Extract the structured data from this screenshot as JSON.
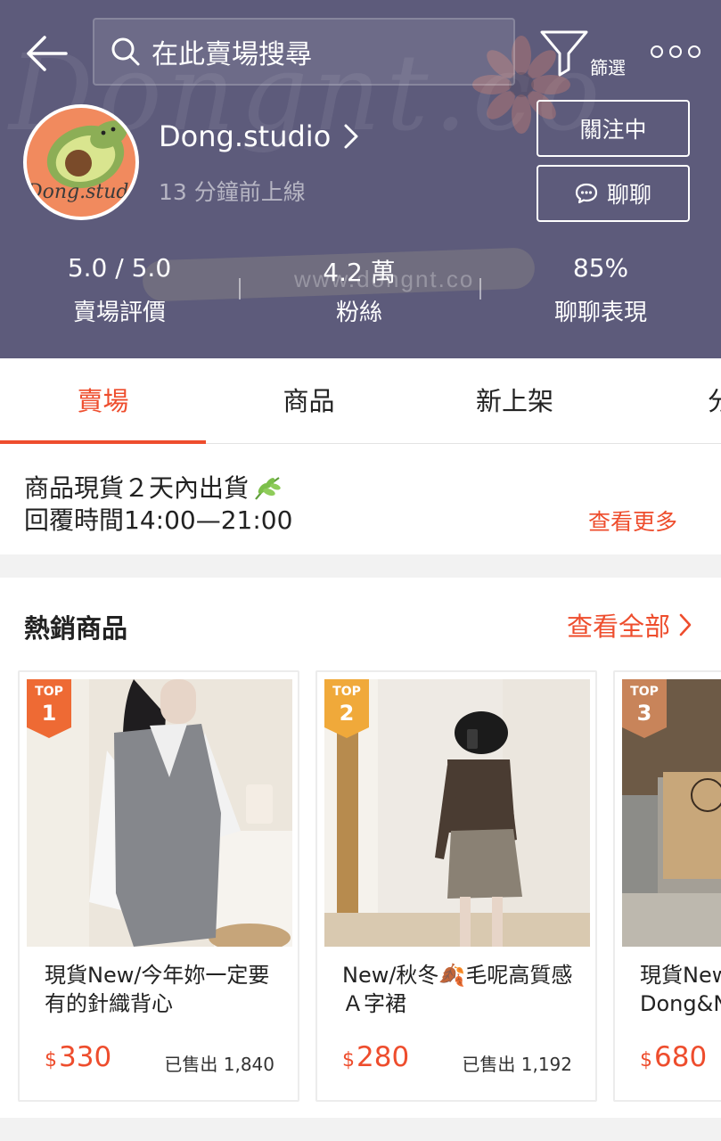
{
  "header": {
    "search_placeholder": "在此賣場搜尋",
    "filter_label": "篩選",
    "watermark_text": "Dongnt.co",
    "watermark_url": "www.dongnt.co"
  },
  "shop": {
    "avatar_text": "Dong.studio",
    "name": "Dong.studio",
    "last_online": "13 分鐘前上線",
    "follow_label": "關注中",
    "chat_label": "聊聊"
  },
  "stats": [
    {
      "value": "5.0 / 5.0",
      "label": "賣場評價"
    },
    {
      "value": "4.2 萬",
      "label": "粉絲"
    },
    {
      "value": "85%",
      "label": "聊聊表現"
    }
  ],
  "tabs": [
    {
      "label": "賣場",
      "active": true
    },
    {
      "label": "商品",
      "active": false
    },
    {
      "label": "新上架",
      "active": false
    },
    {
      "label": "分",
      "active": false
    }
  ],
  "notice": {
    "line1": "商品現貨２天內出貨",
    "line2": "回覆時間14:00—21:00",
    "see_more": "查看更多"
  },
  "hot_section": {
    "title": "熱銷商品",
    "see_all": "查看全部"
  },
  "products": [
    {
      "rank_label": "TOP",
      "rank": "1",
      "badge_color": "#ee6a34",
      "name": "現貨New/今年妳一定要有的針織背心",
      "currency": "$",
      "price": "330",
      "sold": "已售出 1,840"
    },
    {
      "rank_label": "TOP",
      "rank": "2",
      "badge_color": "#f0a93a",
      "name": "New/秋冬🍂毛呢高質感Ａ字裙",
      "currency": "$",
      "price": "280",
      "sold": "已售出 1,192"
    },
    {
      "rank_label": "TOP",
      "rank": "3",
      "badge_color": "#c8845a",
      "name": "現貨New\nDong&N",
      "currency": "$",
      "price": "680",
      "sold": ""
    }
  ],
  "colors": {
    "header_bg": "#5d5b7b",
    "accent": "#ee4d2d"
  }
}
